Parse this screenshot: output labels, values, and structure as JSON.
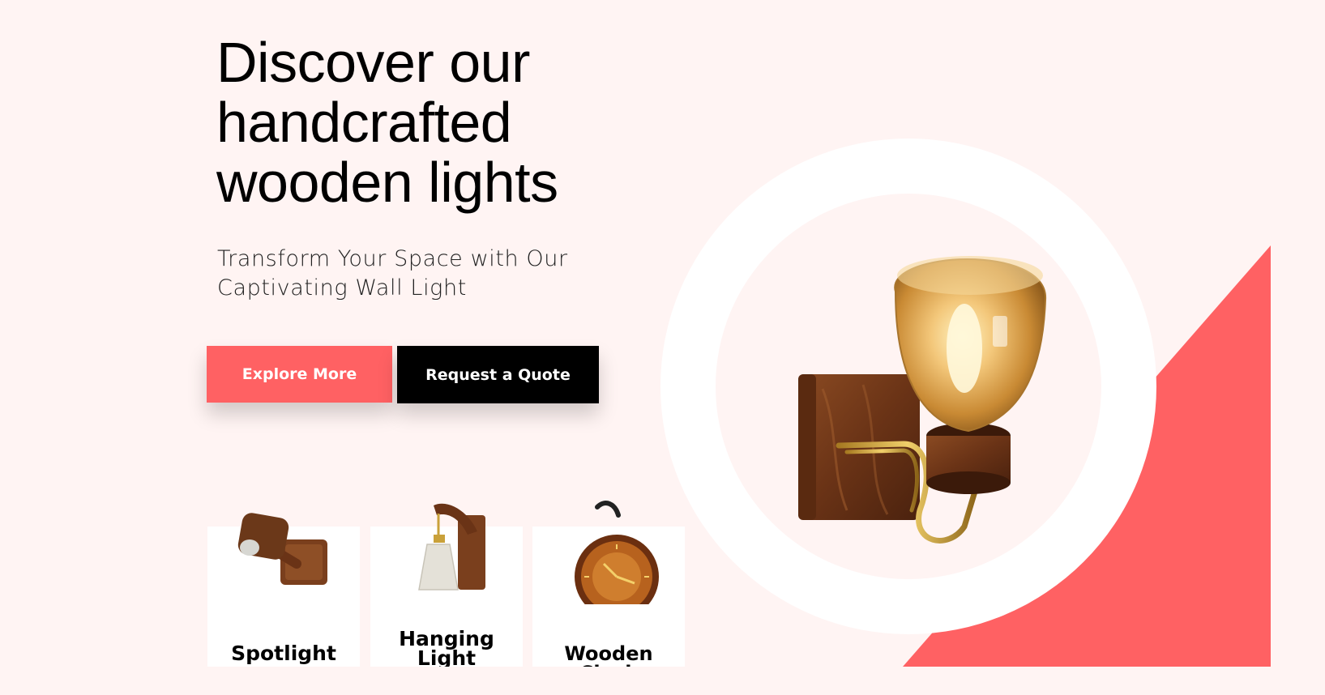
{
  "hero": {
    "title_line1": "Discover our",
    "title_line2": "handcrafted",
    "title_line3": "wooden lights",
    "subtitle_line1": "Transform Your Space with Our",
    "subtitle_line2": "Captivating Wall Light"
  },
  "buttons": {
    "explore_label": "Explore More",
    "quote_label": "Request a Quote"
  },
  "categories": [
    {
      "label": "Spotlight",
      "icon": "spotlight-icon"
    },
    {
      "label": "Hanging Light",
      "icon": "hanging-light-icon"
    },
    {
      "label": "Wooden Clock",
      "icon": "wooden-clock-icon"
    }
  ],
  "colors": {
    "background": "#fff4f3",
    "accent": "#ff6163",
    "dark_button": "#000000",
    "wood": "#7a3f1d"
  }
}
